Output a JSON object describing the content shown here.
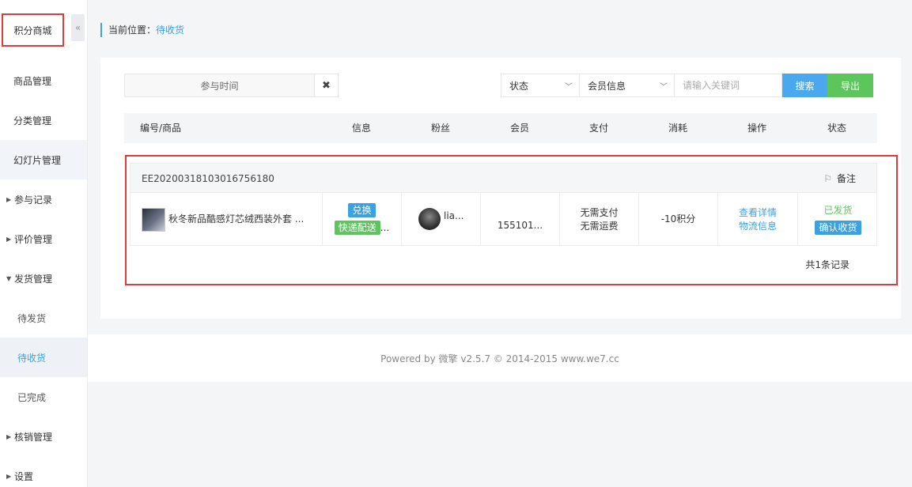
{
  "sidebar": {
    "title": "积分商城",
    "collapse_icon": "«",
    "items": [
      {
        "label": "商品管理"
      },
      {
        "label": "分类管理"
      },
      {
        "label": "幻灯片管理"
      },
      {
        "label": "参与记录"
      },
      {
        "label": "评价管理"
      },
      {
        "label": "发货管理"
      },
      {
        "label": "待发货"
      },
      {
        "label": "待收货"
      },
      {
        "label": "已完成"
      },
      {
        "label": "核销管理"
      },
      {
        "label": "设置"
      }
    ]
  },
  "breadcrumb": {
    "prefix": "当前位置：",
    "current": "待收货"
  },
  "filters": {
    "time_label": "参与时间",
    "clear_icon": "✖",
    "status_select": "状态",
    "member_select": "会员信息",
    "keyword_placeholder": "请输入关键词",
    "search_label": "搜索",
    "export_label": "导出"
  },
  "table": {
    "columns": [
      "编号/商品",
      "信息",
      "粉丝",
      "会员",
      "支付",
      "消耗",
      "操作",
      "状态"
    ]
  },
  "order": {
    "number": "EE20200318103016756180",
    "remark_icon": "⚐",
    "remark_label": "备注",
    "goods_name": "秋冬新品酷感灯芯绒西装外套 ...",
    "tag_exchange": "兑换",
    "tag_delivery": "快递配送",
    "tag_more": "...",
    "fan_name": "lia...",
    "member": "155101...",
    "pay_line1": "无需支付",
    "pay_line2": "无需运费",
    "consume": "-10积分",
    "op_detail": "查看详情",
    "op_logistics": "物流信息",
    "status": "已发货",
    "confirm_button": "确认收货"
  },
  "total_text": "共1条记录",
  "footer": "Powered by 微擎 v2.5.7 © 2014-2015 www.we7.cc"
}
